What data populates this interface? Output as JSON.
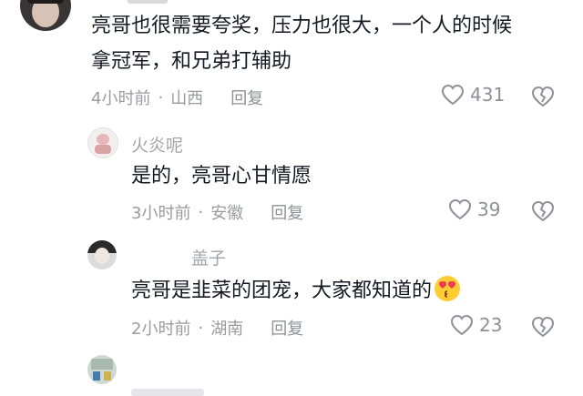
{
  "comments": [
    {
      "text_line1": "亮哥也很需要夸奖，压力也很大，一个人的时候",
      "text_line2": "拿冠军，和兄弟打辅助",
      "time": "4小时前",
      "location": "山西",
      "reply_label": "回复",
      "likes": "431"
    },
    {
      "username": "火炎呢",
      "text": "是的，亮哥心甘情愿",
      "time": "3小时前",
      "location": "安徽",
      "reply_label": "回复",
      "likes": "39"
    },
    {
      "username": "盖子",
      "text": "亮哥是韭菜的团宠，大家都知道的",
      "emoji": "heart-eyes-emoji",
      "time": "2小时前",
      "location": "湖南",
      "reply_label": "回复",
      "likes": "23"
    }
  ],
  "separator": "·",
  "colors": {
    "text": "#161823",
    "meta": "#9a9ba1",
    "username": "#a3a4ab",
    "icon": "#8f9097"
  }
}
